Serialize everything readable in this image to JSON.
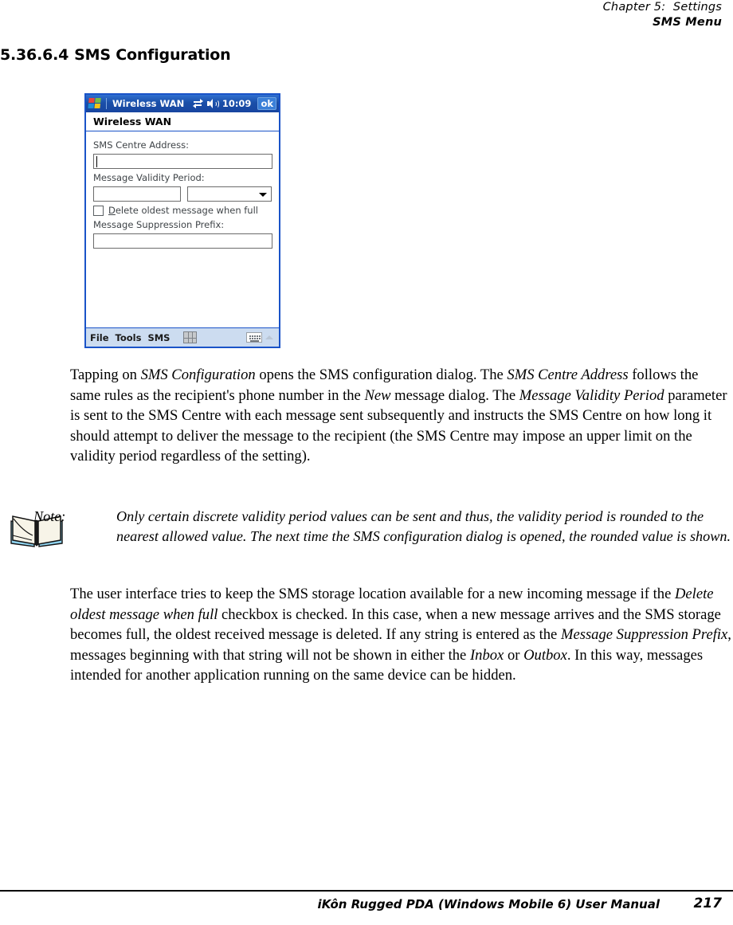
{
  "header": {
    "chapter": "Chapter 5:  Settings",
    "section": "SMS Menu"
  },
  "heading": {
    "number": "5.36.6.4",
    "title": "SMS Configuration"
  },
  "pda": {
    "titlebar": {
      "app_title": "Wireless WAN",
      "time": "10:09",
      "ok_label": "ok",
      "icons": [
        "windows-flag-icon",
        "connectivity-icon",
        "speaker-icon"
      ]
    },
    "page_header": "Wireless WAN",
    "fields": {
      "sms_centre_address_label": "SMS Centre Address:",
      "sms_centre_address_value": "",
      "message_validity_period_label": "Message Validity Period:",
      "message_validity_value": "",
      "message_validity_unit": "",
      "delete_oldest_checkbox_label_pre": "",
      "delete_oldest_accel": "D",
      "delete_oldest_checkbox_label": "elete oldest message when full",
      "delete_oldest_checked": false,
      "message_suppression_prefix_label": "Message Suppression Prefix:",
      "message_suppression_prefix_value": ""
    },
    "taskbar": {
      "menu_file": "File",
      "menu_tools": "Tools",
      "menu_sms": "SMS",
      "grid_icon": "grid-icon",
      "sip_icon": "keyboard-icon"
    }
  },
  "paragraphs": {
    "p1_a": "Tapping on ",
    "p1_i1": "SMS Configuration",
    "p1_b": " opens the SMS configuration dialog. The ",
    "p1_i2": "SMS Centre Address",
    "p1_c": " follows the same rules as the recipient's phone number in the ",
    "p1_i3": "New",
    "p1_d": " message dialog. The ",
    "p1_i4": "Message Validity Period",
    "p1_e": " parameter is sent to the SMS Centre with each message sent subsequently and instructs the SMS Centre on how long it should attempt to deliver the message to the recipient (the SMS Centre may impose an upper limit on the validity period regardless of the setting).",
    "p2_a": "The user interface tries to keep the SMS storage location available for a new incoming message if the ",
    "p2_i1": "Delete oldest message when full",
    "p2_b": " checkbox is checked. In this case, when a new message arrives and the SMS storage becomes full, the oldest received message is deleted. If any string is entered as the ",
    "p2_i2": "Message Suppression Prefix",
    "p2_c": ", messages beginning with that string will not be shown in either the ",
    "p2_i3": "Inbox",
    "p2_d": " or ",
    "p2_i4": "Outbox",
    "p2_e": ". In this way, messages intended for another application running on the same device can be hidden."
  },
  "note": {
    "label": "Note:",
    "text": "Only certain discrete validity period values can be sent and thus, the validity period is rounded to the nearest allowed value. The next time the SMS configuration dialog is opened, the rounded value is shown.",
    "icon": "open-book-icon"
  },
  "footer": {
    "title": "iKôn Rugged PDA (Windows Mobile 6) User Manual",
    "page_number": "217"
  }
}
